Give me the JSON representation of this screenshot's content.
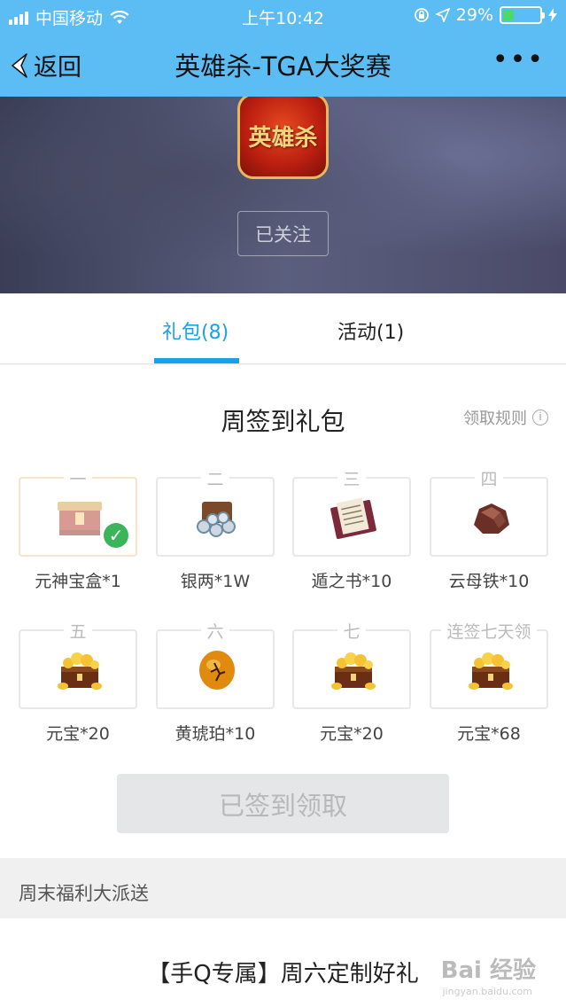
{
  "status": {
    "carrier": "中国移动",
    "time": "上午10:42",
    "battery": "29%",
    "battery_level": 0.29
  },
  "nav": {
    "back_label": "返回",
    "title": "英雄杀-TGA大奖赛",
    "more_label": "•••"
  },
  "hero": {
    "logo_text": "英雄杀",
    "follow_label": "已关注"
  },
  "tabs": [
    {
      "label": "礼包(8)",
      "active": true
    },
    {
      "label": "活动(1)",
      "active": false
    }
  ],
  "signin": {
    "title": "周签到礼包",
    "rules_label": "领取规则",
    "info_icon": "i",
    "items": [
      {
        "day": "一",
        "name": "元神宝盒*1",
        "icon": "treasure-box-icon",
        "claimed": true
      },
      {
        "day": "二",
        "name": "银两*1W",
        "icon": "silver-coins-icon",
        "claimed": false
      },
      {
        "day": "三",
        "name": "遁之书*10",
        "icon": "scroll-book-icon",
        "claimed": false
      },
      {
        "day": "四",
        "name": "云母铁*10",
        "icon": "ore-icon",
        "claimed": false
      },
      {
        "day": "五",
        "name": "元宝*20",
        "icon": "gold-chest-icon",
        "claimed": false
      },
      {
        "day": "六",
        "name": "黄琥珀*10",
        "icon": "amber-icon",
        "claimed": false
      },
      {
        "day": "七",
        "name": "元宝*20",
        "icon": "gold-chest-icon",
        "claimed": false
      },
      {
        "day": "连签七天领",
        "name": "元宝*68",
        "icon": "gold-chest-icon",
        "claimed": false
      }
    ],
    "claim_label": "已签到领取"
  },
  "weekend": {
    "header": "周末福利大派送",
    "gift_title": "【手Q专属】周六定制好礼",
    "watermark": "Bai 经验",
    "watermark_sub": "jingyan.baidu.com"
  },
  "colors": {
    "nav_blue": "#5cbcf4",
    "tab_active": "#1aa0e6",
    "check_green": "#3cb55a"
  }
}
